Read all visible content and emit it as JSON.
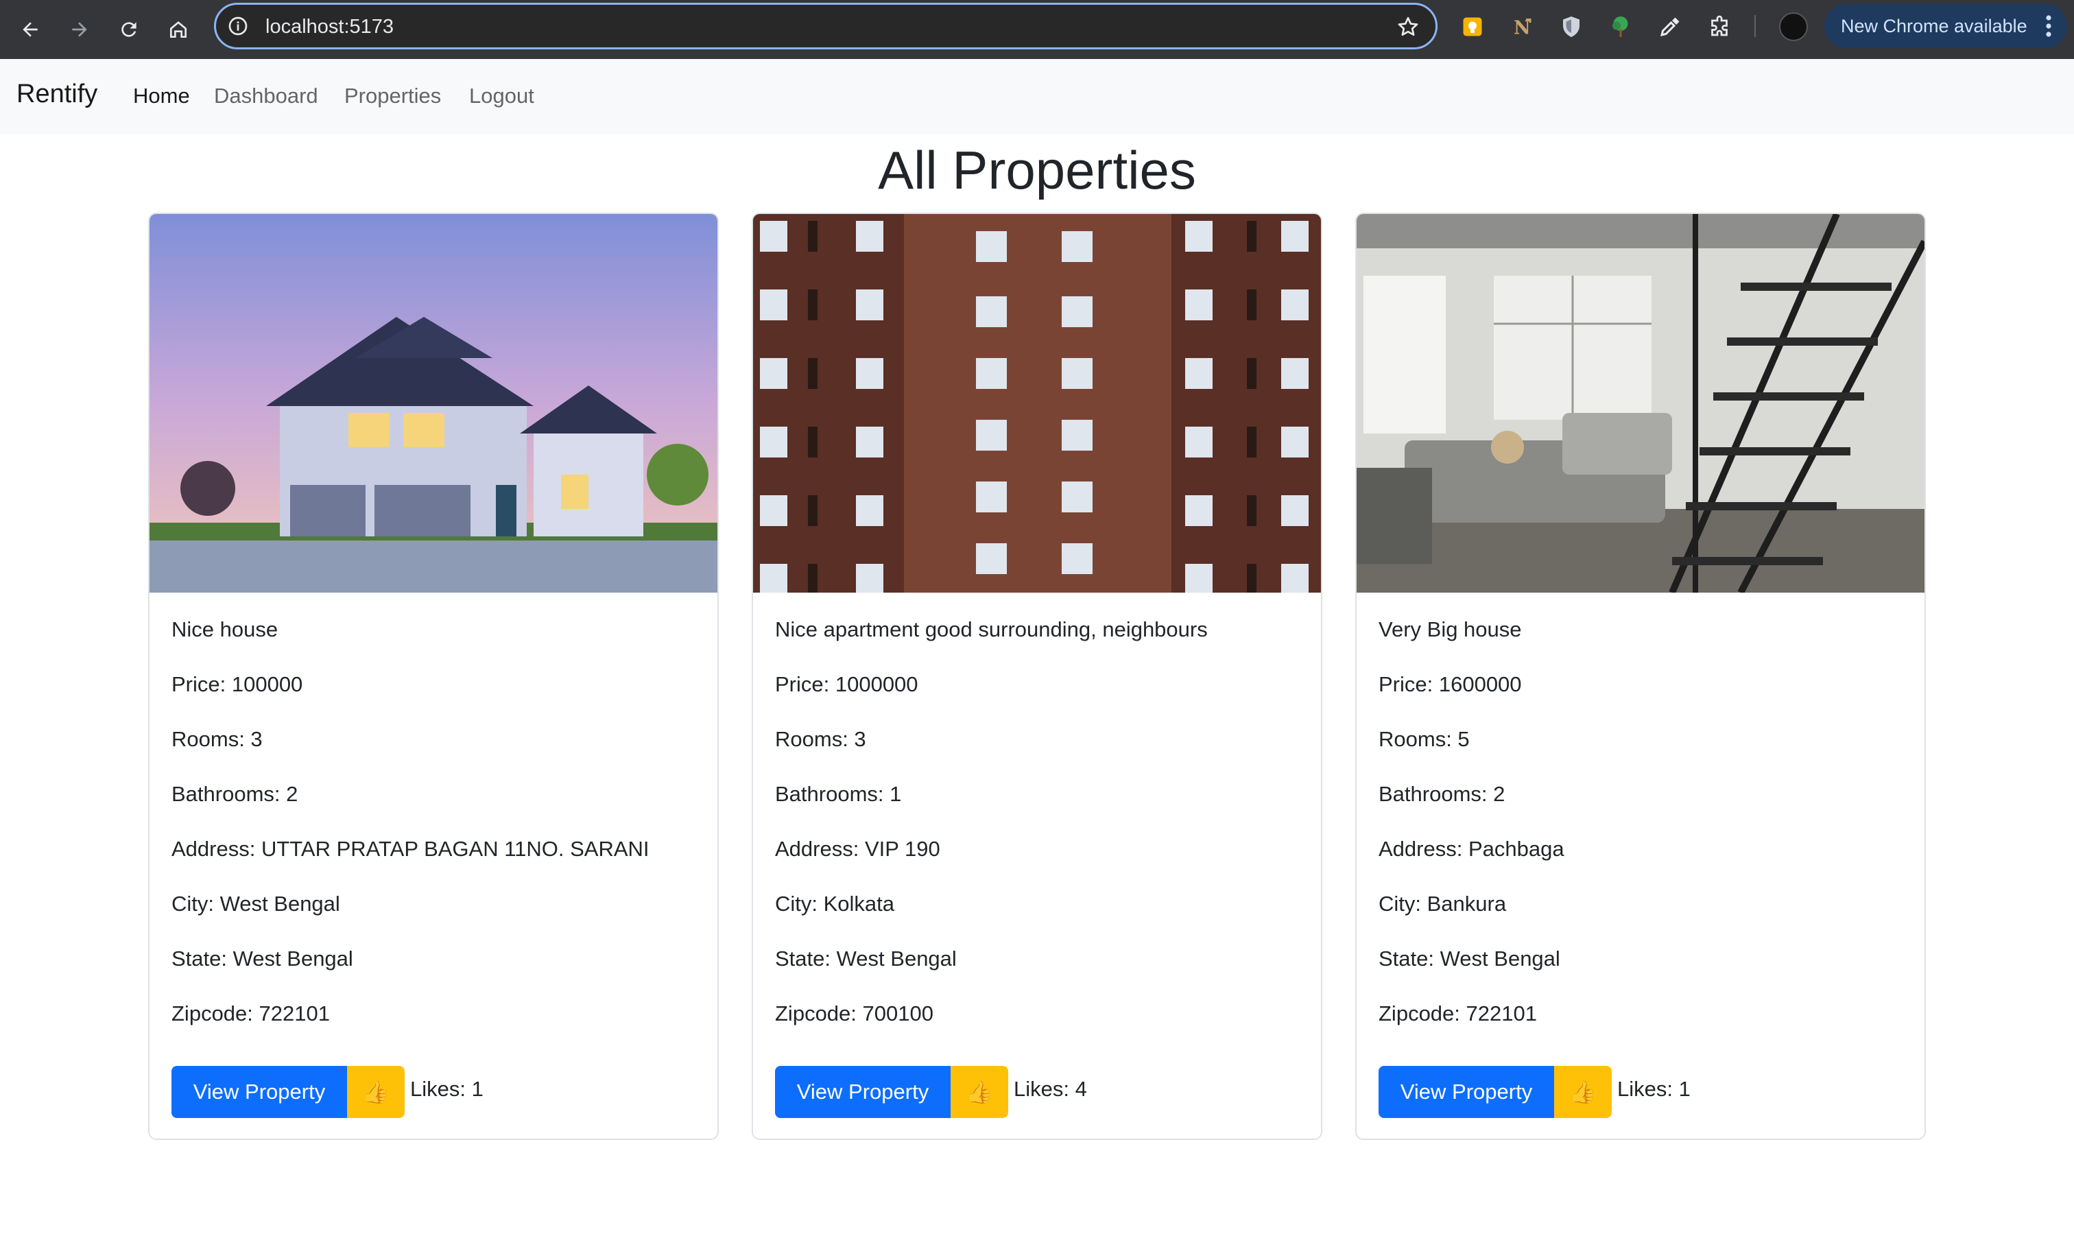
{
  "browser": {
    "url": "localhost:5173",
    "update_label": "New Chrome available",
    "icons": [
      "back-arrow-icon",
      "forward-arrow-icon",
      "reload-icon",
      "home-icon",
      "info-icon",
      "star-icon",
      "extensions-puzzle-icon",
      "eyedropper-icon",
      "menu-dots-icon"
    ]
  },
  "navbar": {
    "brand": "Rentify",
    "links": [
      "Home",
      "Dashboard",
      "Properties",
      "Logout"
    ]
  },
  "page": {
    "title": "All Properties"
  },
  "properties": [
    {
      "description": "Nice house",
      "price": "Price: 100000",
      "rooms": "Rooms: 3",
      "bathrooms": "Bathrooms: 2",
      "address": "Address: UTTAR PRATAP BAGAN 11NO. SARANI",
      "city": "City: West Bengal",
      "state": "State: West Bengal",
      "zipcode": "Zipcode: 722101",
      "view_label": "View Property",
      "like_icon": "👍",
      "likes": "Likes: 1"
    },
    {
      "description": "Nice apartment good surrounding, neighbours",
      "price": "Price: 1000000",
      "rooms": "Rooms: 3",
      "bathrooms": "Bathrooms: 1",
      "address": "Address: VIP 190",
      "city": "City: Kolkata",
      "state": "State: West Bengal",
      "zipcode": "Zipcode: 700100",
      "view_label": "View Property",
      "like_icon": "👍",
      "likes": "Likes: 4"
    },
    {
      "description": "Very Big house",
      "price": "Price: 1600000",
      "rooms": "Rooms: 5",
      "bathrooms": "Bathrooms: 2",
      "address": "Address: Pachbaga",
      "city": "City: Bankura",
      "state": "State: West Bengal",
      "zipcode": "Zipcode: 722101",
      "view_label": "View Property",
      "like_icon": "👍",
      "likes": "Likes: 1"
    }
  ],
  "colors": {
    "primary": "#0d6efd",
    "warning": "#ffc107",
    "navbar_bg": "#f8f9fa",
    "chrome_bg": "#35363a",
    "omnibox_focus": "#8ab4f8"
  }
}
